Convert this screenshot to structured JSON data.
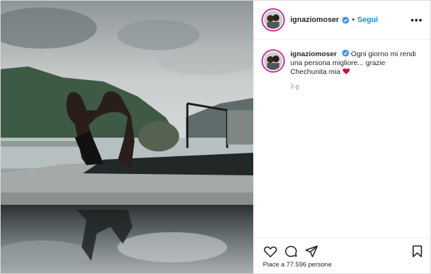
{
  "post": {
    "username": "ignaziomoser",
    "follow_label": "Segui",
    "separator": "•",
    "more_label": "•••"
  },
  "caption": {
    "username": "ignaziomoser",
    "text": "Ogni giorno mi rendi una persona migliore... grazie Chechunita mia",
    "time": "3 g"
  },
  "likes": {
    "text": "Piace a 77.596 persone"
  },
  "icons": {
    "like": "heart-outline-icon",
    "comment": "comment-icon",
    "share": "paper-plane-icon",
    "save": "bookmark-icon",
    "verified": "verified-badge-icon"
  },
  "colors": {
    "follow": "#0095f6",
    "verified": "#3897f0",
    "heart": "#c8102e",
    "story_ring": "#d6249f"
  }
}
